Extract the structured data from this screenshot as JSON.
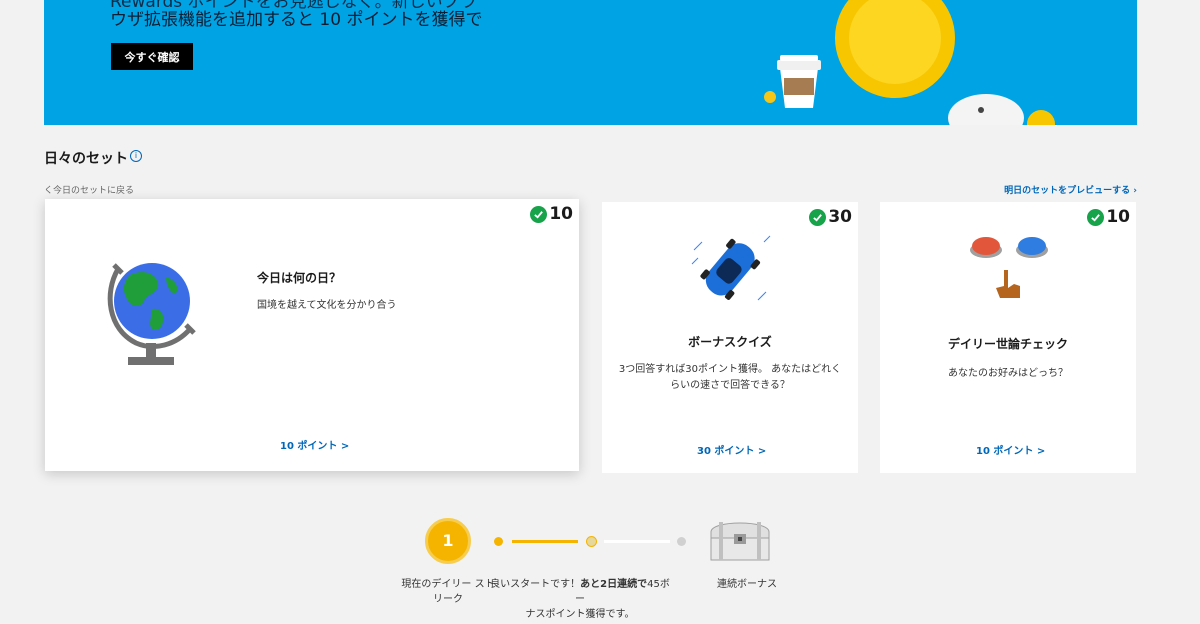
{
  "hero": {
    "line1": "Rewards ポイントをお見逃しなく。新しいブラ",
    "line2": "ウザ拡張機能を追加すると 10 ポイントを獲得で",
    "button": "今すぐ確認"
  },
  "section": {
    "title": "日々のセット",
    "info_icon": "i",
    "back_link": "く今日のセットに戻る",
    "preview_link": "明日のセットをプレビューする ›"
  },
  "cards": [
    {
      "points_badge": "10",
      "title": "今日は何の日？",
      "description": "国境を越えて文化を分かり合う",
      "link": "10 ポイント >",
      "icon": "globe-icon"
    },
    {
      "points_badge": "30",
      "title": "ボーナスクイズ",
      "description_line1": "3つ回答すれば30ポイント獲得。 あなたはどれく",
      "description_line2": "らいの速さで回答できる？",
      "link": "30 ポイント >",
      "icon": "race-car-icon"
    },
    {
      "points_badge": "10",
      "title": "デイリー世論チェック",
      "description": "あなたのお好みはどっち？",
      "link": "10 ポイント >",
      "icon": "buttons-poll-icon"
    }
  ],
  "streak": {
    "count": "1",
    "label_line1": "現在のデイリー スト",
    "label_line2": "リーク",
    "message_prefix": "良いスタートです！",
    "message_bold": "あと2日連続で",
    "message_suffix": "45ボー",
    "message_line2": "ナスポイント獲得です。",
    "bonus_label": "連続ボーナス",
    "colors": {
      "active": "#f5b400",
      "inactive": "#d0d0d0"
    }
  },
  "colors": {
    "hero_bg": "#00a4e4",
    "link": "#0067b8",
    "check": "#16a34a"
  }
}
